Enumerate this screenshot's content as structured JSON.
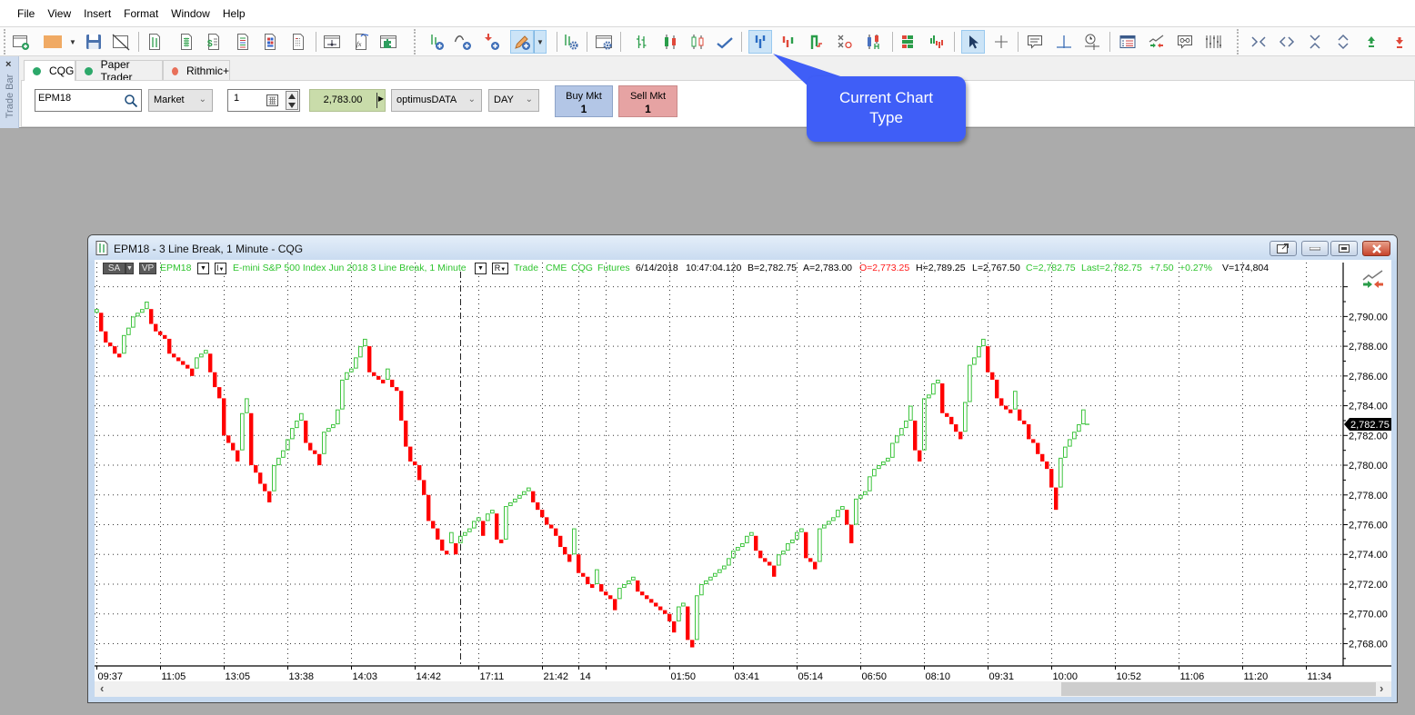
{
  "menu": [
    "File",
    "View",
    "Insert",
    "Format",
    "Window",
    "Help"
  ],
  "toolbar": {
    "items": [
      {
        "icon": "new-chart-window"
      },
      {
        "icon": "link-color",
        "dropdown": true
      },
      {
        "icon": "save"
      },
      {
        "icon": "unlink-window"
      },
      {
        "icon": "chart-window"
      },
      {
        "icon": "quote-board"
      },
      {
        "icon": "dom-trader"
      },
      {
        "icon": "news-window"
      },
      {
        "icon": "portfolio-monitor"
      },
      {
        "icon": "spreadsheet"
      },
      {
        "icon": "window-anchor"
      },
      {
        "icon": "formula-builder"
      },
      {
        "icon": "add-ins"
      },
      {
        "icon": "add-study"
      },
      {
        "icon": "add-curve"
      },
      {
        "icon": "add-trade-arrow"
      },
      {
        "icon": "drawing-tools",
        "dropdown": true,
        "active": true
      },
      {
        "icon": "study-settings"
      },
      {
        "icon": "chart-settings"
      },
      {
        "icon": "bar-chart"
      },
      {
        "icon": "candlestick-chart"
      },
      {
        "icon": "hollow-candlestick-chart"
      },
      {
        "icon": "line-chart"
      },
      {
        "icon": "line-break-chart",
        "active": true
      },
      {
        "icon": "kagi-chart"
      },
      {
        "icon": "step-chart"
      },
      {
        "icon": "point-figure-chart"
      },
      {
        "icon": "tfl-chart"
      },
      {
        "icon": "market-profile"
      },
      {
        "icon": "volume-profile"
      },
      {
        "icon": "pointer-tool",
        "active": true
      },
      {
        "icon": "crosshair-tool"
      },
      {
        "icon": "annotation-tool"
      },
      {
        "icon": "horizontal-line-tool"
      },
      {
        "icon": "time-line-tool"
      },
      {
        "icon": "data-window"
      },
      {
        "icon": "trade-chart"
      },
      {
        "icon": "watch-list"
      },
      {
        "icon": "equalizer"
      },
      {
        "icon": "compress-horizontal"
      },
      {
        "icon": "expand-horizontal"
      },
      {
        "icon": "compress-vertical"
      },
      {
        "icon": "expand-vertical"
      },
      {
        "icon": "move-up"
      },
      {
        "icon": "move-down"
      }
    ]
  },
  "trade_bar": {
    "side_label": "Trade Bar",
    "close_label": "×",
    "tabs": [
      {
        "label": "CQG",
        "status_color": "#2ca86a"
      },
      {
        "label": "Paper Trader",
        "status_color": "#2ca86a"
      },
      {
        "label": "Rithmic+",
        "status_color": "#e8705a"
      }
    ],
    "symbol": "EPM18",
    "order_type": "Market",
    "quantity": "1",
    "price": "2,783.00",
    "account": "optimusDATA",
    "duration": "DAY",
    "buy": {
      "label": "Buy Mkt",
      "qty": "1"
    },
    "sell": {
      "label": "Sell Mkt",
      "qty": "1"
    }
  },
  "callout": {
    "line1": "Current Chart",
    "line2": "Type"
  },
  "colors": {
    "up_bar": "#3ec43e",
    "down_bar": "#ff0000",
    "info_green": "#2fc42f",
    "info_red": "#ff1a1a",
    "callout": "#3f5ef7",
    "price_field": "#c9dcaa",
    "buy": "#b3c6e6",
    "sell": "#e6a3a3"
  },
  "chart_window": {
    "title": "EPM18 - 3 Line Break, 1 Minute - CQG",
    "info": {
      "sa": "SA",
      "vp": "VP",
      "symbol": "EPM18",
      "i_button": "I",
      "description": "E-mini S&P 500 Index Jun 2018  3 Line Break, 1 Minute",
      "r_button": "R",
      "trade": "Trade",
      "exchange": "CME",
      "feed": "CQG",
      "instrument_type": "Futures",
      "date": "6/14/2018",
      "time": "10:47:04.120",
      "bid": "B=2,782.75",
      "ask": "A=2,783.00",
      "open": "O=2,773.25",
      "high": "H=2,789.25",
      "low": "L=2,767.50",
      "close": "C=2,782.75",
      "last": "Last=2,782.75",
      "change": "+7.50",
      "change_pct": "+0.27%",
      "volume": "V=174,804"
    },
    "scroll_left": "‹",
    "scroll_right": "›"
  },
  "chart_data": {
    "type": "bar",
    "style": "3 Line Break",
    "title": "EPM18 - 3 Line Break, 1 Minute - CQG",
    "xlabel": "",
    "ylabel": "",
    "grid": true,
    "ylim": [
      2766.5,
      2792.65
    ],
    "xlim": [
      0,
      274.6
    ],
    "last_price": 2782.75,
    "last_price_label": "2,782.75",
    "session_break_at_bar": 80,
    "y_ticks": [
      {
        "value": 2792,
        "label": ""
      },
      {
        "value": 2790,
        "label": "2,790.00"
      },
      {
        "value": 2788,
        "label": "2,788.00"
      },
      {
        "value": 2786,
        "label": "2,786.00"
      },
      {
        "value": 2784,
        "label": "2,784.00"
      },
      {
        "value": 2782,
        "label": "2,782.00"
      },
      {
        "value": 2780,
        "label": "2,780.00"
      },
      {
        "value": 2778,
        "label": "2,778.00"
      },
      {
        "value": 2776,
        "label": "2,776.00"
      },
      {
        "value": 2774,
        "label": "2,774.00"
      },
      {
        "value": 2772,
        "label": "2,772.00"
      },
      {
        "value": 2770,
        "label": "2,770.00"
      },
      {
        "value": 2768,
        "label": "2,768.00"
      }
    ],
    "x_ticks": [
      {
        "bar": 0,
        "label": "09:37"
      },
      {
        "bar": 14,
        "label": "11:05"
      },
      {
        "bar": 28,
        "label": "13:05"
      },
      {
        "bar": 42,
        "label": "13:38"
      },
      {
        "bar": 56,
        "label": "14:03"
      },
      {
        "bar": 70,
        "label": "14:42"
      },
      {
        "bar": 84,
        "label": "17:11"
      },
      {
        "bar": 98,
        "label": "21:42"
      },
      {
        "bar": 106,
        "label": "14"
      },
      {
        "bar": 112,
        "label": ""
      },
      {
        "bar": 126,
        "label": "01:50"
      },
      {
        "bar": 140,
        "label": "03:41"
      },
      {
        "bar": 154,
        "label": "05:14"
      },
      {
        "bar": 168,
        "label": "06:50"
      },
      {
        "bar": 182,
        "label": "08:10"
      },
      {
        "bar": 196,
        "label": "09:31"
      },
      {
        "bar": 210,
        "label": "10:00"
      },
      {
        "bar": 224,
        "label": "10:52"
      },
      {
        "bar": 238,
        "label": "11:06"
      },
      {
        "bar": 252,
        "label": "11:20"
      },
      {
        "bar": 266,
        "label": "11:34"
      }
    ],
    "bars_open_close": [
      [
        2790.25,
        2790.5
      ],
      [
        2790.25,
        2789
      ],
      [
        2789,
        2788.25
      ],
      [
        2788.25,
        2788
      ],
      [
        2788,
        2787.5
      ],
      [
        2787.5,
        2787.25
      ],
      [
        2787.5,
        2788.75
      ],
      [
        2788.75,
        2789.25
      ],
      [
        2789.25,
        2790
      ],
      [
        2790,
        2790.25
      ],
      [
        2790.25,
        2790.5
      ],
      [
        2790.5,
        2791
      ],
      [
        2790.5,
        2789.5
      ],
      [
        2789.5,
        2789
      ],
      [
        2789,
        2788.75
      ],
      [
        2788.75,
        2788.5
      ],
      [
        2788.5,
        2787.5
      ],
      [
        2787.5,
        2787.25
      ],
      [
        2787.25,
        2787
      ],
      [
        2787,
        2786.75
      ],
      [
        2786.75,
        2786.5
      ],
      [
        2786.5,
        2786
      ],
      [
        2786.5,
        2787.25
      ],
      [
        2787.25,
        2787.5
      ],
      [
        2787.5,
        2787.75
      ],
      [
        2787.5,
        2786.25
      ],
      [
        2786.25,
        2785.25
      ],
      [
        2785.25,
        2784.5
      ],
      [
        2784.5,
        2782
      ],
      [
        2782,
        2781.5
      ],
      [
        2781.5,
        2781
      ],
      [
        2781,
        2780.25
      ],
      [
        2781,
        2783.5
      ],
      [
        2783.5,
        2784.5
      ],
      [
        2783.5,
        2780
      ],
      [
        2780,
        2779.5
      ],
      [
        2779.5,
        2778.75
      ],
      [
        2778.75,
        2778.25
      ],
      [
        2778.25,
        2777.5
      ],
      [
        2778.25,
        2780
      ],
      [
        2780,
        2780.5
      ],
      [
        2780.5,
        2781
      ],
      [
        2781,
        2781.75
      ],
      [
        2781.75,
        2782.5
      ],
      [
        2782.5,
        2783
      ],
      [
        2783,
        2783.5
      ],
      [
        2783,
        2781.5
      ],
      [
        2781.5,
        2781
      ],
      [
        2781,
        2780.75
      ],
      [
        2780.75,
        2780
      ],
      [
        2780.75,
        2782.25
      ],
      [
        2782.25,
        2782.5
      ],
      [
        2782.5,
        2782.75
      ],
      [
        2782.75,
        2783.75
      ],
      [
        2783.75,
        2785.75
      ],
      [
        2785.75,
        2786.25
      ],
      [
        2786.25,
        2786.5
      ],
      [
        2786.5,
        2787.25
      ],
      [
        2787.25,
        2788
      ],
      [
        2788,
        2788.5
      ],
      [
        2788,
        2786.25
      ],
      [
        2786.25,
        2786
      ],
      [
        2786,
        2785.75
      ],
      [
        2785.75,
        2785.5
      ],
      [
        2785.75,
        2786.5
      ],
      [
        2785.75,
        2785.25
      ],
      [
        2785.25,
        2785
      ],
      [
        2785,
        2783
      ],
      [
        2783,
        2781.25
      ],
      [
        2781.25,
        2780.25
      ],
      [
        2780.25,
        2780
      ],
      [
        2780,
        2779
      ],
      [
        2779,
        2778
      ],
      [
        2778,
        2776.25
      ],
      [
        2776.25,
        2775.75
      ],
      [
        2775.75,
        2775
      ],
      [
        2775,
        2774.25
      ],
      [
        2774.25,
        2774
      ],
      [
        2774.75,
        2775.5
      ],
      [
        2774.75,
        2774
      ],
      [
        2774.75,
        2775.25
      ],
      [
        2775.25,
        2775.5
      ],
      [
        2775.5,
        2775.75
      ],
      [
        2775.75,
        2776.25
      ],
      [
        2776.25,
        2776.5
      ],
      [
        2776.25,
        2775.25
      ],
      [
        2776.25,
        2776.75
      ],
      [
        2776.75,
        2777
      ],
      [
        2776.75,
        2775
      ],
      [
        2775,
        2774.75
      ],
      [
        2775,
        2777.25
      ],
      [
        2777.25,
        2777.5
      ],
      [
        2777.5,
        2777.75
      ],
      [
        2777.75,
        2778
      ],
      [
        2778,
        2778.25
      ],
      [
        2778.25,
        2778.5
      ],
      [
        2778.25,
        2777.5
      ],
      [
        2777.5,
        2777
      ],
      [
        2777,
        2776.5
      ],
      [
        2776.5,
        2776
      ],
      [
        2776,
        2775.75
      ],
      [
        2775.75,
        2775.25
      ],
      [
        2775.25,
        2774.5
      ],
      [
        2774.5,
        2774
      ],
      [
        2774,
        2773.5
      ],
      [
        2774,
        2775.75
      ],
      [
        2774,
        2772.75
      ],
      [
        2772.75,
        2772.5
      ],
      [
        2772.5,
        2772
      ],
      [
        2772,
        2771.75
      ],
      [
        2772,
        2773
      ],
      [
        2772,
        2771.5
      ],
      [
        2771.5,
        2771.25
      ],
      [
        2771.25,
        2771
      ],
      [
        2771,
        2770.25
      ],
      [
        2771,
        2771.75
      ],
      [
        2771.75,
        2772
      ],
      [
        2772,
        2772.25
      ],
      [
        2772.25,
        2772.5
      ],
      [
        2772.25,
        2771.5
      ],
      [
        2771.5,
        2771.25
      ],
      [
        2771.25,
        2771
      ],
      [
        2771,
        2770.75
      ],
      [
        2770.75,
        2770.5
      ],
      [
        2770.5,
        2770.25
      ],
      [
        2770.25,
        2770
      ],
      [
        2770,
        2769.5
      ],
      [
        2769.5,
        2768.75
      ],
      [
        2769.5,
        2770.5
      ],
      [
        2770.5,
        2770.75
      ],
      [
        2770.5,
        2768.25
      ],
      [
        2768.25,
        2767.75
      ],
      [
        2768.25,
        2771.25
      ],
      [
        2771.25,
        2772
      ],
      [
        2772,
        2772.25
      ],
      [
        2772.25,
        2772.5
      ],
      [
        2772.5,
        2772.75
      ],
      [
        2772.75,
        2773
      ],
      [
        2773,
        2773.25
      ],
      [
        2773.25,
        2773.75
      ],
      [
        2773.75,
        2774.25
      ],
      [
        2774.25,
        2774.5
      ],
      [
        2774.5,
        2774.75
      ],
      [
        2774.75,
        2775.25
      ],
      [
        2775.25,
        2775.5
      ],
      [
        2775.25,
        2774.25
      ],
      [
        2774.25,
        2773.75
      ],
      [
        2773.75,
        2773.5
      ],
      [
        2773.5,
        2773.25
      ],
      [
        2773.25,
        2772.5
      ],
      [
        2773.25,
        2774
      ],
      [
        2774,
        2774.25
      ],
      [
        2774.25,
        2774.75
      ],
      [
        2774.75,
        2775
      ],
      [
        2775,
        2775.5
      ],
      [
        2775.5,
        2775.75
      ],
      [
        2775.5,
        2773.75
      ],
      [
        2773.75,
        2773.5
      ],
      [
        2773.5,
        2773
      ],
      [
        2773.5,
        2775.75
      ],
      [
        2775.75,
        2776
      ],
      [
        2776,
        2776.25
      ],
      [
        2776.25,
        2776.5
      ],
      [
        2776.5,
        2777
      ],
      [
        2777,
        2777.25
      ],
      [
        2777,
        2776
      ],
      [
        2776,
        2774.75
      ],
      [
        2776,
        2777.75
      ],
      [
        2777.75,
        2778
      ],
      [
        2778,
        2778.25
      ],
      [
        2778.25,
        2779.25
      ],
      [
        2779.25,
        2779.75
      ],
      [
        2779.75,
        2780
      ],
      [
        2780,
        2780.25
      ],
      [
        2780.25,
        2780.5
      ],
      [
        2780.5,
        2781.5
      ],
      [
        2781.5,
        2782
      ],
      [
        2782,
        2782.5
      ],
      [
        2782.5,
        2783
      ],
      [
        2783,
        2784
      ],
      [
        2783,
        2781
      ],
      [
        2781,
        2780.25
      ],
      [
        2781,
        2784.5
      ],
      [
        2784.5,
        2784.75
      ],
      [
        2784.75,
        2785.5
      ],
      [
        2785.5,
        2785.75
      ],
      [
        2785.5,
        2783.5
      ],
      [
        2783.5,
        2783.25
      ],
      [
        2783.25,
        2782.75
      ],
      [
        2782.75,
        2782.25
      ],
      [
        2782.25,
        2781.75
      ],
      [
        2782.25,
        2784.25
      ],
      [
        2784.25,
        2786.75
      ],
      [
        2786.75,
        2787.25
      ],
      [
        2787.25,
        2788
      ],
      [
        2788,
        2788.5
      ],
      [
        2788,
        2786.25
      ],
      [
        2786.25,
        2785.75
      ],
      [
        2785.75,
        2784.5
      ],
      [
        2784.5,
        2784
      ],
      [
        2784,
        2783.75
      ],
      [
        2783.75,
        2783.5
      ],
      [
        2783.75,
        2785
      ],
      [
        2783.75,
        2783
      ],
      [
        2783,
        2782.75
      ],
      [
        2782.75,
        2781.75
      ],
      [
        2781.75,
        2781.5
      ],
      [
        2781.5,
        2780.75
      ],
      [
        2780.75,
        2780.25
      ],
      [
        2780.25,
        2779.75
      ],
      [
        2779.75,
        2778.5
      ],
      [
        2778.5,
        2777
      ],
      [
        2778.5,
        2780.5
      ],
      [
        2780.5,
        2781.25
      ],
      [
        2781.25,
        2781.75
      ],
      [
        2781.75,
        2782.25
      ],
      [
        2782.25,
        2782.75
      ],
      [
        2782.75,
        2783.75
      ]
    ]
  }
}
